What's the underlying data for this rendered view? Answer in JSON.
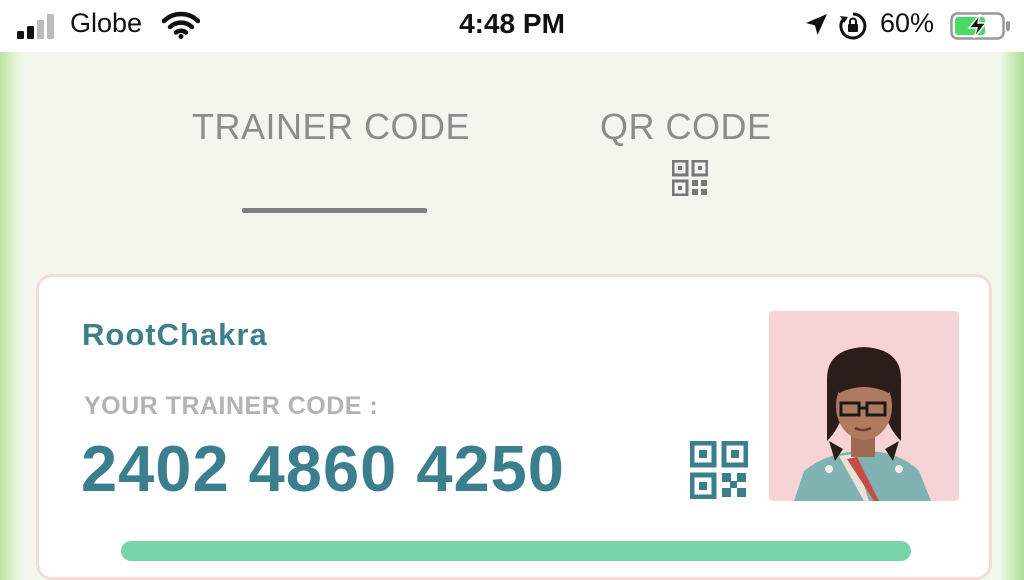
{
  "status_bar": {
    "carrier": "Globe",
    "time": "4:48 PM",
    "battery_percent": "60%",
    "icons": [
      "signal-icon",
      "wifi-icon",
      "location-arrow-icon",
      "rotation-lock-icon",
      "battery-charging-icon"
    ]
  },
  "tabs": [
    {
      "label": "TRAINER CODE",
      "active": true
    },
    {
      "label": "QR CODE",
      "active": false,
      "icon": "qr-code-icon"
    }
  ],
  "card": {
    "username": "RootChakra",
    "code_label": "YOUR TRAINER CODE :",
    "trainer_code": "2402 4860 4250",
    "qr_icon": "qr-code-icon",
    "avatar": "trainer-avatar"
  },
  "colors": {
    "accent_teal": "#3b7f8f",
    "tab_gray": "#8c8c8c",
    "card_border": "#f6d9d9",
    "avatar_bg": "#f6d3d6",
    "button_green": "#79d3a8",
    "battery_green": "#4cd964"
  }
}
